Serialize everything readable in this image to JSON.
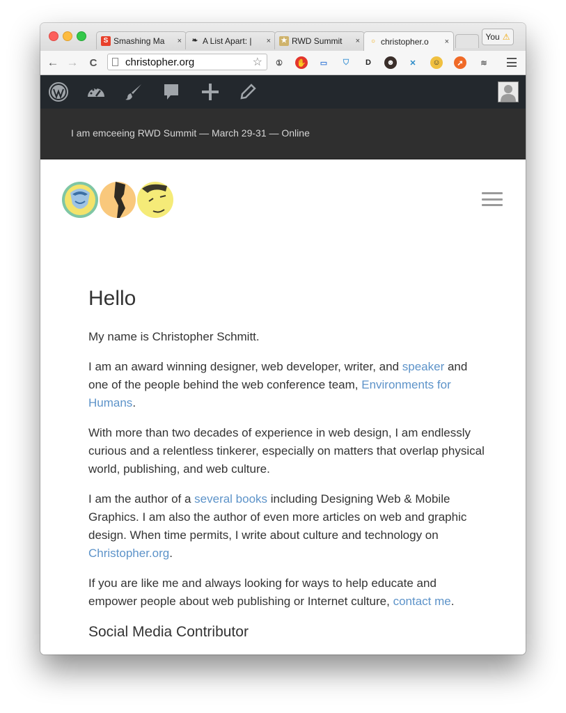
{
  "browser": {
    "tabs": [
      {
        "title": "Smashing Ma",
        "favicon": "S",
        "favicon_bg": "#e8402a",
        "favicon_color": "#ffffff",
        "close": "×"
      },
      {
        "title": "A List Apart: |",
        "favicon": "❧",
        "favicon_bg": "transparent",
        "favicon_color": "#222222",
        "close": "×"
      },
      {
        "title": "RWD Summit",
        "favicon": "★",
        "favicon_bg": "#cfb36b",
        "favicon_color": "#ffffff",
        "close": "×"
      },
      {
        "title": "christopher.o",
        "favicon": "○",
        "favicon_bg": "transparent",
        "favicon_color": "#f0a500",
        "close": "×",
        "active": true
      }
    ],
    "profile_label": "You",
    "profile_warning": "⚠",
    "url": "christopher.org",
    "back": "←",
    "forward": "→",
    "reload": "C",
    "bookmark_star": "☆"
  },
  "extensions": [
    {
      "name": "1password-icon",
      "glyph": "①",
      "color": "#444444",
      "bg": "transparent"
    },
    {
      "name": "adblock-icon",
      "glyph": "✋",
      "color": "#ffffff",
      "bg": "#e3352c"
    },
    {
      "name": "cast-icon",
      "glyph": "▭",
      "color": "#3f7fd8",
      "bg": "transparent"
    },
    {
      "name": "shield-icon",
      "glyph": "⛉",
      "color": "#4a9ad6",
      "bg": "transparent"
    },
    {
      "name": "d4-icon",
      "glyph": "D",
      "color": "#222222",
      "bg": "transparent"
    },
    {
      "name": "ghostery-icon",
      "glyph": "☻",
      "color": "#ffffff",
      "bg": "#3a2e2a"
    },
    {
      "name": "crosshair-icon",
      "glyph": "✕",
      "color": "#2a8bc8",
      "bg": "transparent"
    },
    {
      "name": "face-icon",
      "glyph": "☺",
      "color": "#333333",
      "bg": "#f0c040"
    },
    {
      "name": "rocket-icon",
      "glyph": "➚",
      "color": "#ffffff",
      "bg": "#f06a27"
    },
    {
      "name": "stack-icon",
      "glyph": "≋",
      "color": "#666666",
      "bg": "transparent"
    }
  ],
  "adminbar": {
    "icons": [
      "wordpress-icon",
      "dashboard-icon",
      "customize-brush-icon",
      "comments-icon",
      "new-content-icon",
      "edit-pencil-icon"
    ]
  },
  "banner": {
    "text": "I am emceeing RWD Summit — March 29-31 — Online"
  },
  "page": {
    "heading": "Hello",
    "p1": "My name is Christopher Schmitt.",
    "p2_a": "I am an award winning designer, web developer, writer, and ",
    "p2_link1": "speaker",
    "p2_b": " and one of the people behind the web conference team, ",
    "p2_link2": "Environments for Humans",
    "p2_c": ".",
    "p3": "With more than two decades of experience in web design, I am endlessly curious and a relentless tinkerer, especially on matters that overlap physical world, publishing, and web culture.",
    "p4_a": "I am the author of a ",
    "p4_link1": "several books",
    "p4_b": " including Designing Web & Mobile Graphics. I am also the author of even more articles on web and graphic design. When time permits, I write about culture and technology on ",
    "p4_link2": "Christopher.org",
    "p4_c": ".",
    "p5_a": "If you are like me and always looking for ways to help educate and empower people about web publishing or Internet culture, ",
    "p5_link": "contact me",
    "p5_b": ".",
    "subheading": "Social Media Contributor"
  },
  "colors": {
    "link": "#5d93c9",
    "adminbar": "#23282d",
    "banner": "#2f2f2f",
    "logo_faces": [
      "#7fc6a4",
      "#f9c87c",
      "#f5eb78"
    ]
  }
}
